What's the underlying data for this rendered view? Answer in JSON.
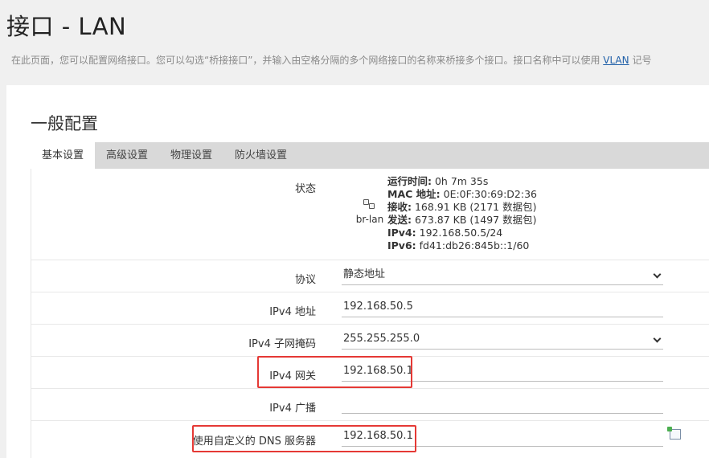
{
  "page": {
    "title": "接口 - LAN",
    "description_prefix": "在此页面，您可以配置网络接口。您可以勾选“桥接接口”，并输入由空格分隔的多个网络接口的名称来桥接多个接口。接口名称中可以使用 ",
    "description_link": "VLAN",
    "description_suffix": " 记号"
  },
  "section": {
    "title": "一般配置"
  },
  "tabs": [
    {
      "label": "基本设置",
      "active": true
    },
    {
      "label": "高级设置",
      "active": false
    },
    {
      "label": "物理设置",
      "active": false
    },
    {
      "label": "防火墙设置",
      "active": false
    }
  ],
  "status": {
    "label": "状态",
    "interface_name": "br-lan",
    "interface_icon": "network-bridge-icon",
    "lines": [
      {
        "key": "运行时间:",
        "value": " 0h 7m 35s"
      },
      {
        "key": "MAC 地址:",
        "value": " 0E:0F:30:69:D2:36"
      },
      {
        "key": "接收:",
        "value": " 168.91 KB (2171 数据包)"
      },
      {
        "key": "发送:",
        "value": " 673.87 KB (1497 数据包)"
      },
      {
        "key": "IPv4:",
        "value": " 192.168.50.5/24"
      },
      {
        "key": "IPv6:",
        "value": " fd41:db26:845b::1/60"
      }
    ]
  },
  "form": {
    "protocol": {
      "label": "协议",
      "value": "静态地址"
    },
    "ipv4_address": {
      "label": "IPv4 地址",
      "value": "192.168.50.5"
    },
    "ipv4_netmask": {
      "label": "IPv4 子网掩码",
      "value": "255.255.255.0"
    },
    "ipv4_gateway": {
      "label": "IPv4 网关",
      "value": "192.168.50.1"
    },
    "ipv4_broadcast": {
      "label": "IPv4 广播",
      "value": ""
    },
    "custom_dns": {
      "label": "使用自定义的 DNS 服务器",
      "value": "192.168.50.1"
    }
  },
  "highlight_color": "#e53935"
}
